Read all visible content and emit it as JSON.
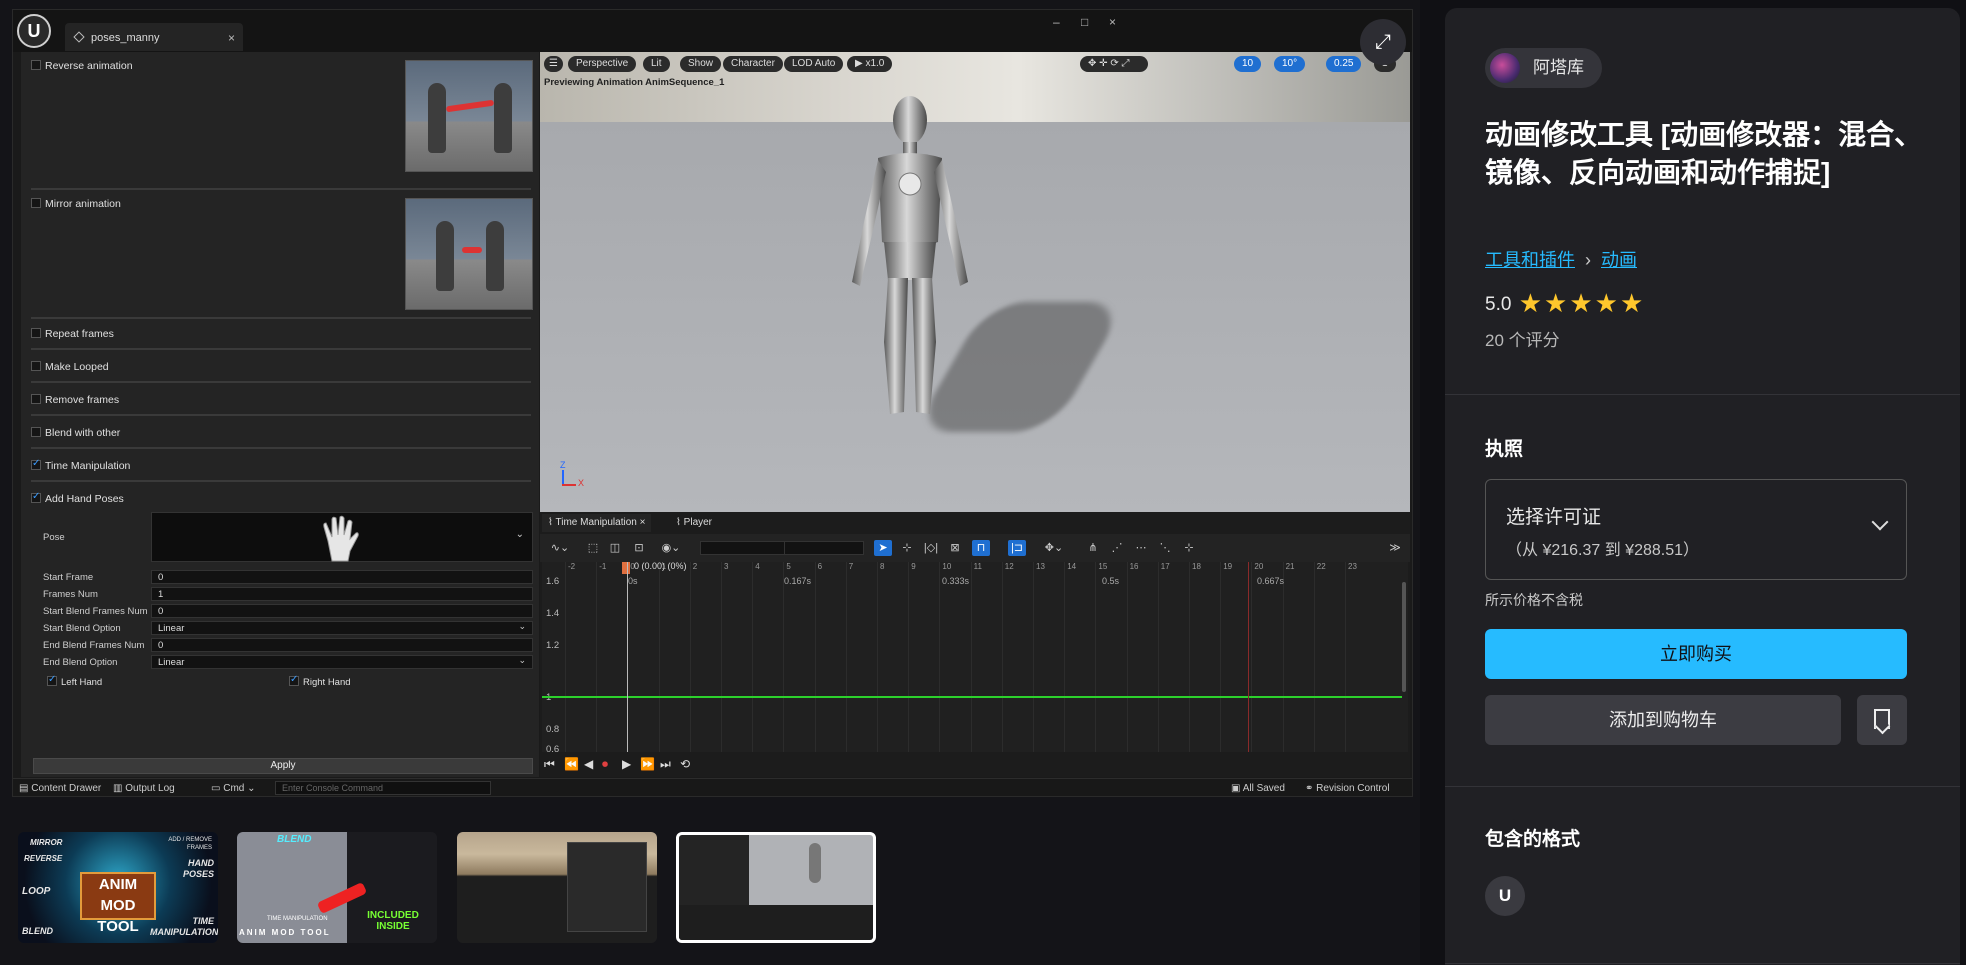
{
  "editor": {
    "tab_label": "poses_manny",
    "tab_close": "×",
    "win_min": "–",
    "win_max": "□",
    "win_close": "×",
    "left_panel": {
      "options": [
        {
          "label": "Reverse animation",
          "checked": false
        },
        {
          "label": "Mirror animation",
          "checked": false
        },
        {
          "label": "Repeat frames",
          "checked": false
        },
        {
          "label": "Make Looped",
          "checked": false
        },
        {
          "label": "Remove frames",
          "checked": false
        },
        {
          "label": "Blend with other",
          "checked": false
        },
        {
          "label": "Time Manipulation",
          "checked": true
        },
        {
          "label": "Add Hand Poses",
          "checked": true
        }
      ],
      "pose_label": "Pose",
      "fields": [
        {
          "label": "Start Frame",
          "value": "0"
        },
        {
          "label": "Frames Num",
          "value": "1"
        },
        {
          "label": "Start Blend Frames Num",
          "value": "0"
        },
        {
          "label": "Start Blend Option",
          "value": "Linear"
        },
        {
          "label": "End Blend Frames Num",
          "value": "0"
        },
        {
          "label": "End Blend Option",
          "value": "Linear"
        }
      ],
      "left_hand": "Left Hand",
      "right_hand": "Right Hand",
      "apply_label": "Apply"
    },
    "viewport": {
      "buttons": [
        "Perspective",
        "Lit",
        "Show",
        "Character",
        "LOD Auto",
        "x1.0"
      ],
      "right_values": [
        "10",
        "10°",
        "0.25",
        "1"
      ],
      "caption": "Previewing Animation AnimSequence_1",
      "axis_z": "Z",
      "axis_x": "X"
    },
    "timeline": {
      "tab_time": "Time Manipulation",
      "tab_time_close": "×",
      "tab_player": "Player",
      "frame_ticks": [
        "-2",
        "-1",
        "0",
        "1",
        "2",
        "3",
        "4",
        "5",
        "6",
        "7",
        "8",
        "9",
        "10",
        "11",
        "12",
        "13",
        "14",
        "15",
        "16",
        "17",
        "18",
        "19",
        "20",
        "21",
        "22",
        "23"
      ],
      "time_labels": [
        "0s",
        "0.167s",
        "0.333s",
        "0.5s",
        "0.667s"
      ],
      "playhead_label": "0 (0.00) (0%)",
      "y_labels": [
        "1.6",
        "1.4",
        "1.2",
        "1",
        "0.8",
        "0.6"
      ]
    },
    "status": {
      "content_drawer": "Content Drawer",
      "output_log": "Output Log",
      "cmd": "Cmd",
      "console_placeholder": "Enter Console Command",
      "saved": "All Saved",
      "revision": "Revision Control"
    }
  },
  "gallery": {
    "thumb1": {
      "title": "ANIM MOD TOOL",
      "labels": [
        "MIRROR",
        "REVERSE",
        "HAND POSES",
        "LOOP",
        "BLEND",
        "TIME MANIPULATION",
        "ADD / REMOVE FRAMES"
      ]
    },
    "thumb2": {
      "labels": [
        "BLEND",
        "INCLUDED INSIDE",
        "ANIM MOD TOOL",
        "TIME MANIPULATION"
      ]
    }
  },
  "product": {
    "seller": "阿塔库",
    "title": "动画修改工具 [动画修改器：混合、镜像、反向动画和动作捕捉]",
    "breadcrumb": [
      "工具和插件",
      "动画"
    ],
    "rating": "5.0",
    "stars": 5,
    "review_count": "20 个评分",
    "license_heading": "执照",
    "license_select_title": "选择许可证",
    "license_price_range": "（从 ¥216.37 到 ¥288.51）",
    "tax_note": "所示价格不含税",
    "buy_label": "立即购买",
    "cart_label": "添加到购物车",
    "formats_heading": "包含的格式",
    "accent": "#26bbff"
  }
}
